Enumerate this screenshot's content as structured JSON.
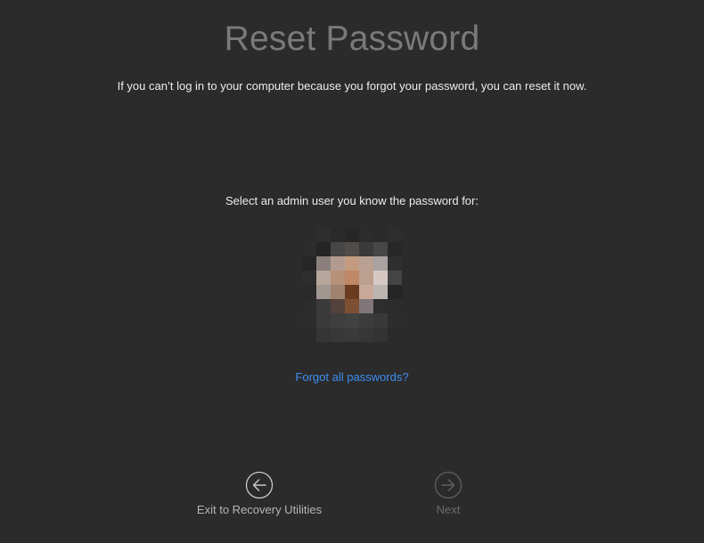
{
  "header": {
    "title": "Reset Password",
    "subtitle": "If you can’t log in to your computer because you forgot your password, you can reset it now."
  },
  "main": {
    "prompt": "Select an admin user you know the password for:",
    "forgot_link": "Forgot all passwords?",
    "avatar_pixels": [
      [
        "#2b2b2b",
        "#2e2e2e",
        "#2a2a2a",
        "#262626",
        "#2c2c2c",
        "#2a2a2a",
        "#2d2d2d"
      ],
      [
        "#2c2c2c",
        "#252525",
        "#464646",
        "#514b49",
        "#3a3a3a",
        "#474747",
        "#272727"
      ],
      [
        "#262626",
        "#8a7f7c",
        "#b39a90",
        "#c49a80",
        "#baa093",
        "#a8a2a0",
        "#2f2f2f"
      ],
      [
        "#2e2e2e",
        "#b8a69c",
        "#b79078",
        "#bf8867",
        "#bca08f",
        "#d6c9c3",
        "#444"
      ],
      [
        "#2a2a2a",
        "#a29690",
        "#a0836f",
        "#6b3b20",
        "#c9a999",
        "#bdb5b1",
        "#252525"
      ],
      [
        "#2c2c2c",
        "#3a3a3a",
        "#53413b",
        "#7d5034",
        "#807678",
        "#2d2d2d",
        "#2c2c2c"
      ],
      [
        "#2d2d2d",
        "#3b3b3b",
        "#3f3f3f",
        "#424242",
        "#3c3c3c",
        "#393939",
        "#2d2d2d"
      ],
      [
        "#2b2b2b",
        "#353535",
        "#383838",
        "#3a3a3a",
        "#363636",
        "#333333",
        "#2b2b2b"
      ]
    ]
  },
  "footer": {
    "back_label": "Exit to Recovery Utilities",
    "next_label": "Next"
  },
  "colors": {
    "background": "#2b2b2b",
    "title": "#7a7a7a",
    "link": "#3d8ef0",
    "disabled": "#6a6a6a"
  },
  "icons": {
    "back": "arrow-left-circle-icon",
    "next": "arrow-right-circle-icon"
  }
}
